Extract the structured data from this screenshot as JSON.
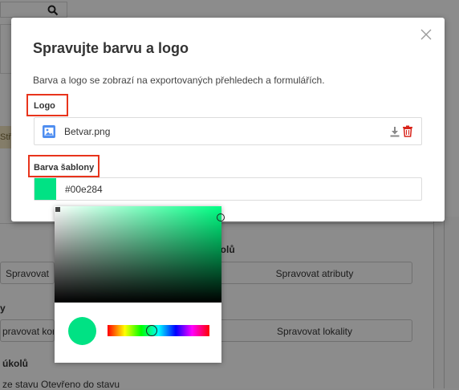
{
  "background": {
    "tag_text": "Stře",
    "section_tasks_suffix": "kolů",
    "btn_manage_left": "Spravovat",
    "btn_manage_attributes": "Spravovat atributy",
    "section_y": "y",
    "btn_manage_controls": "pravovat kontro",
    "btn_manage_locations": "Spravovat lokality",
    "section_tasks": "úkolů",
    "status_text": "ze stavu Otevřeno do stavu"
  },
  "modal": {
    "title": "Spravujte barvu a logo",
    "description": "Barva a logo se zobrazí na exportovaných přehledech a formulářích.",
    "logo_label": "Logo",
    "logo_file_name": "Betvar.png",
    "color_label": "Barva šablony",
    "color_value": "#00e284"
  },
  "colors": {
    "template_color": "#00e284",
    "highlight": "#e8341c",
    "delete_red": "#d9251c"
  },
  "icons": {
    "search": "search-icon",
    "close": "close-icon",
    "image": "image-icon",
    "download": "download-icon",
    "delete": "trash-icon"
  }
}
